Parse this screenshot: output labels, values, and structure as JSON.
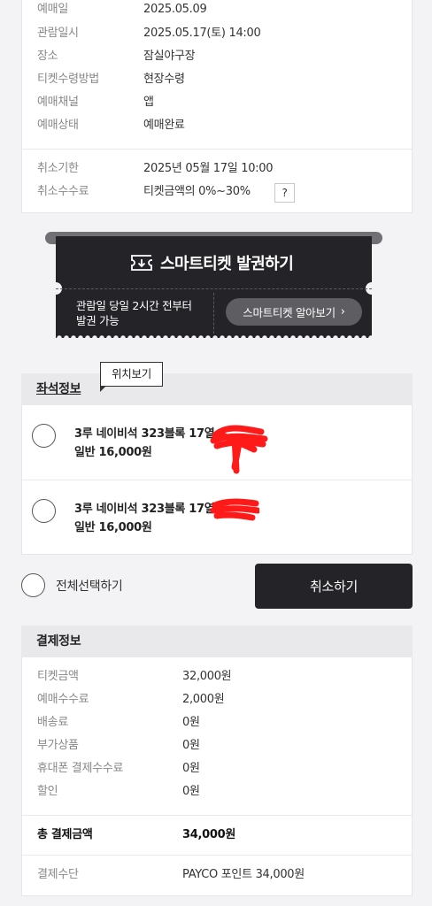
{
  "booking": {
    "rows": [
      {
        "label": "예매일",
        "value": "2025.05.09"
      },
      {
        "label": "관람일시",
        "value": "2025.05.17(토) 14:00"
      },
      {
        "label": "장소",
        "value": "잠실야구장"
      },
      {
        "label": "티켓수령방법",
        "value": "현장수령"
      },
      {
        "label": "예매채널",
        "value": "앱"
      },
      {
        "label": "예매상태",
        "value": "예매완료"
      }
    ],
    "cancel_rows": [
      {
        "label": "취소기한",
        "value": "2025년 05월 17일 10:00"
      },
      {
        "label": "취소수수료",
        "value": "티켓금액의 0%~30%"
      }
    ],
    "help_label": "?"
  },
  "smart_ticket": {
    "title": "스마트티켓 발권하기",
    "note": "관람일 당일 2시간 전부터\n발권 가능",
    "learn_more": "스마트티켓 알아보기",
    "learn_more_icon": "chevron-right-icon",
    "ticket_icon": "ticket-download-icon"
  },
  "seat": {
    "section_title": "좌석정보",
    "tooltip": "위치보기",
    "items": [
      {
        "seat": "3루 네이비석 323블록 17열",
        "price": "일반 16,000원"
      },
      {
        "seat": "3루 네이비석 323블록 17열",
        "price": "일반 16,000원"
      }
    ],
    "select_all": "전체선택하기",
    "cancel_button": "취소하기"
  },
  "payment": {
    "section_title": "결제정보",
    "rows": [
      {
        "label": "티켓금액",
        "value": "32,000원"
      },
      {
        "label": "예매수수료",
        "value": "2,000원"
      },
      {
        "label": "배송료",
        "value": "0원"
      },
      {
        "label": "부가상품",
        "value": "0원"
      },
      {
        "label": "휴대폰 결제수수료",
        "value": "0원"
      },
      {
        "label": "할인",
        "value": "0원"
      }
    ],
    "total": {
      "label": "총 결제금액",
      "value": "34,000원"
    },
    "method": {
      "label": "결제수단",
      "value": "PAYCO 포인트 34,000원"
    }
  },
  "colors": {
    "dark": "#242428",
    "section_bg": "#e9e9ec",
    "page_bg": "#f3f3f5",
    "redaction": "#ff1a1a"
  }
}
